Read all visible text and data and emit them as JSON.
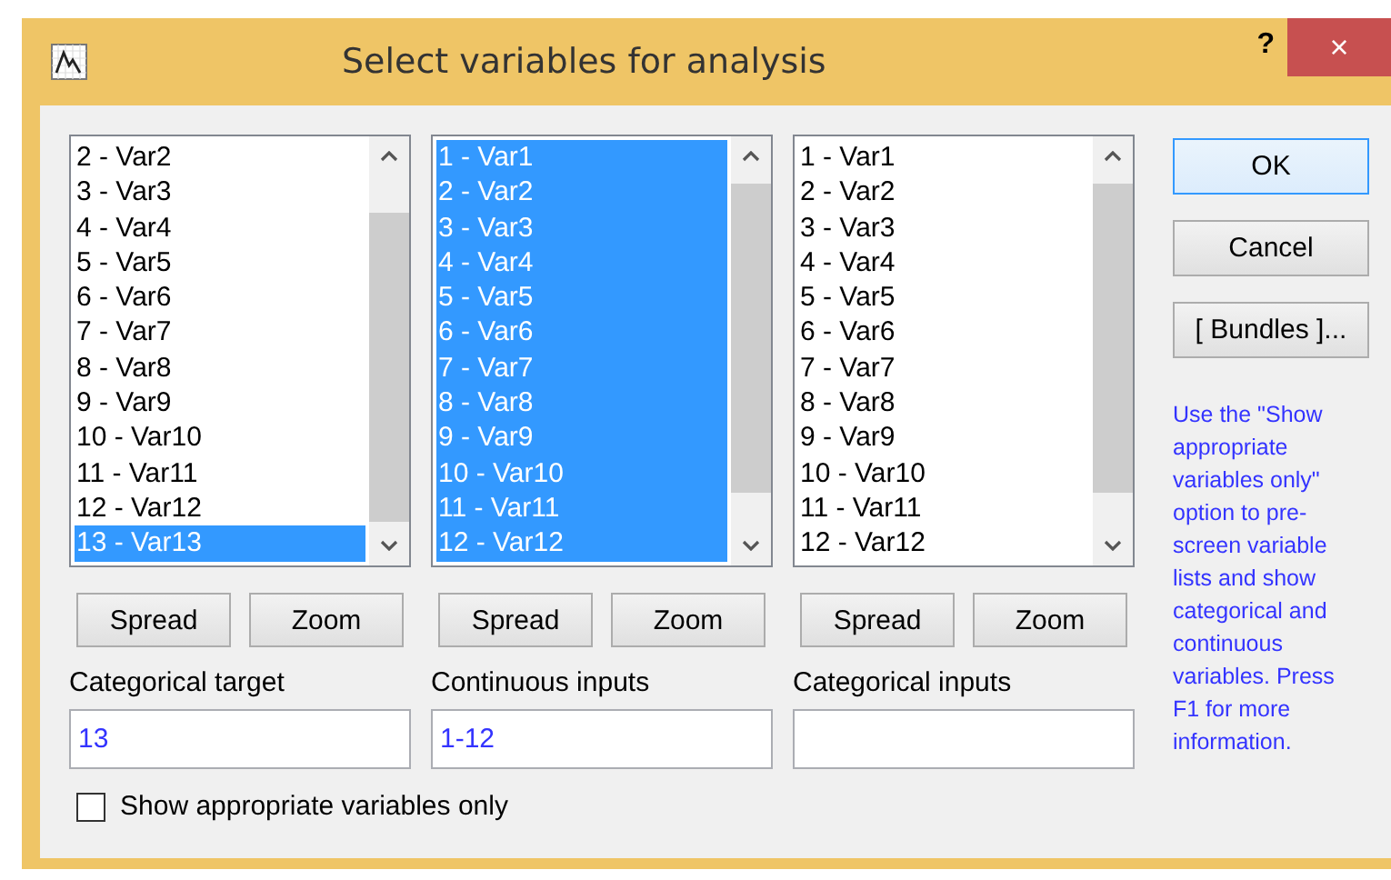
{
  "window": {
    "title": "Select variables for analysis",
    "help_button": "?",
    "close_button": "×"
  },
  "lists": [
    {
      "items": [
        {
          "label": "2 - Var2",
          "selected": false
        },
        {
          "label": "3 - Var3",
          "selected": false
        },
        {
          "label": "4 - Var4",
          "selected": false
        },
        {
          "label": "5 - Var5",
          "selected": false
        },
        {
          "label": "6 - Var6",
          "selected": false
        },
        {
          "label": "7 - Var7",
          "selected": false
        },
        {
          "label": "8 - Var8",
          "selected": false
        },
        {
          "label": "9 - Var9",
          "selected": false
        },
        {
          "label": "10 - Var10",
          "selected": false
        },
        {
          "label": "11 - Var11",
          "selected": false
        },
        {
          "label": "12 - Var12",
          "selected": false
        },
        {
          "label": "13 - Var13",
          "selected": true
        }
      ],
      "buttons": [
        "Spread",
        "Zoom"
      ],
      "label": "Categorical target",
      "value": "13"
    },
    {
      "items": [
        {
          "label": "1 - Var1",
          "selected": true
        },
        {
          "label": "2 - Var2",
          "selected": true
        },
        {
          "label": "3 - Var3",
          "selected": true
        },
        {
          "label": "4 - Var4",
          "selected": true
        },
        {
          "label": "5 - Var5",
          "selected": true
        },
        {
          "label": "6 - Var6",
          "selected": true
        },
        {
          "label": "7 - Var7",
          "selected": true
        },
        {
          "label": "8 - Var8",
          "selected": true
        },
        {
          "label": "9 - Var9",
          "selected": true
        },
        {
          "label": "10 - Var10",
          "selected": true
        },
        {
          "label": "11 - Var11",
          "selected": true
        },
        {
          "label": "12 - Var12",
          "selected": true
        }
      ],
      "buttons": [
        "Spread",
        "Zoom"
      ],
      "label": "Continuous inputs",
      "value": "1-12"
    },
    {
      "items": [
        {
          "label": "1 - Var1",
          "selected": false
        },
        {
          "label": "2 - Var2",
          "selected": false
        },
        {
          "label": "3 - Var3",
          "selected": false
        },
        {
          "label": "4 - Var4",
          "selected": false
        },
        {
          "label": "5 - Var5",
          "selected": false
        },
        {
          "label": "6 - Var6",
          "selected": false
        },
        {
          "label": "7 - Var7",
          "selected": false
        },
        {
          "label": "8 - Var8",
          "selected": false
        },
        {
          "label": "9 - Var9",
          "selected": false
        },
        {
          "label": "10 - Var10",
          "selected": false
        },
        {
          "label": "11 - Var11",
          "selected": false
        },
        {
          "label": "12 - Var12",
          "selected": false
        }
      ],
      "buttons": [
        "Spread",
        "Zoom"
      ],
      "label": "Categorical inputs"
    }
  ],
  "buttons": [
    {
      "label": "OK",
      "default": true
    },
    {
      "label": "Cancel",
      "default": false
    },
    {
      "label": "[ Bundles ]...",
      "default": false
    }
  ],
  "help_text": "Use the \"Show appropriate variables only\" option to pre-screen variable lists and show categorical and continuous variables. Press F1 for more information.",
  "show_appropriate_only": {
    "label": "Show appropriate variables only",
    "checked": false
  }
}
